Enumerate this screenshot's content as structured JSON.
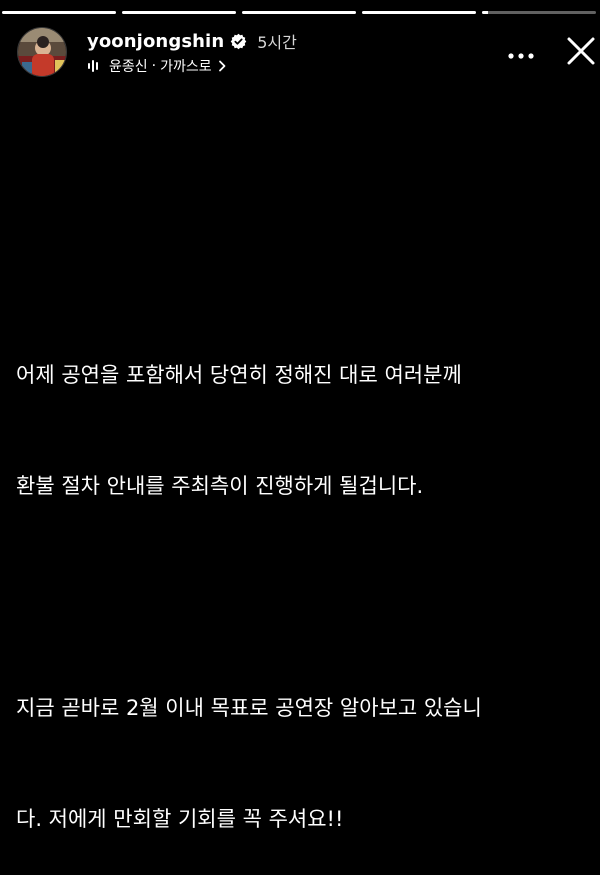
{
  "story": {
    "progress": [
      {
        "fill": 1.0
      },
      {
        "fill": 1.0
      },
      {
        "fill": 1.0
      },
      {
        "fill": 1.0
      },
      {
        "fill": 0.05
      }
    ]
  },
  "header": {
    "username": "yoonjongshin",
    "verified_icon": "verified-badge-icon",
    "time": "5시간",
    "music": {
      "icon": "audio-bars-icon",
      "artist": "윤종신",
      "separator": "·",
      "song": "가까스로",
      "chevron_icon": "chevron-right-icon"
    },
    "more_icon": "more-dots-icon",
    "close_icon": "close-icon"
  },
  "caption": {
    "p1_line1": "어제 공연을 포함해서 당연히 정해진 대로 여러분께",
    "p1_line2": "환불 절차 안내를 주최측이 진행하게 될겁니다.",
    "p2_line1": "지금 곧바로 2월 이내 목표로 공연장 알아보고 있습니",
    "p2_line2": "다. 저에게 만회할 기회를 꼭 주셔요!!"
  },
  "colors": {
    "background": "#000000",
    "text": "#ffffff",
    "verified": "#ffffff",
    "progress_track": "#5e5e5e"
  }
}
